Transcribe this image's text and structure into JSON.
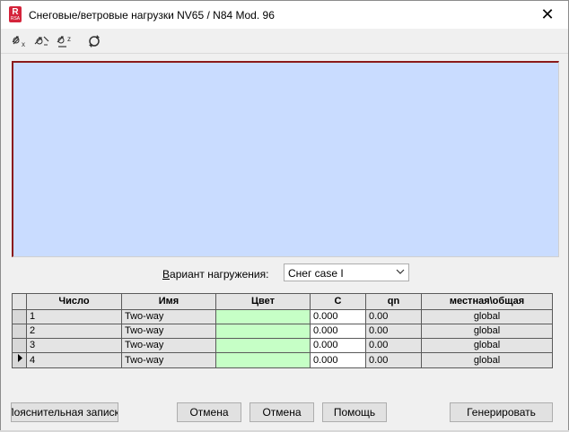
{
  "window": {
    "title": "Снеговые/ветровые нагрузки NV65 / N84 Mod. 96",
    "app_icon_letter": "R",
    "app_icon_sub": "RSA",
    "close_glyph": "✕"
  },
  "toolbar": {
    "icons": [
      "load-arrow-x-icon",
      "load-arrow-edit-icon",
      "load-arrow-z-icon",
      "refresh-icon"
    ]
  },
  "colors": {
    "canvas_bg": "#c9dcff",
    "canvas_border": "#8b1a1a",
    "color_cell": "#c6ffc6"
  },
  "variant": {
    "label_underlined": "В",
    "label_rest": "ариант нагружения:",
    "selected": "Снег case I"
  },
  "grid": {
    "headers": [
      "Число",
      "Имя",
      "Цвет",
      "C",
      "qn",
      "местная\\общая"
    ],
    "rows": [
      {
        "num": "1",
        "name": "Two-way",
        "c": "0.000",
        "qn": "0.00",
        "scope": "global",
        "current": false
      },
      {
        "num": "2",
        "name": "Two-way",
        "c": "0.000",
        "qn": "0.00",
        "scope": "global",
        "current": false
      },
      {
        "num": "3",
        "name": "Two-way",
        "c": "0.000",
        "qn": "0.00",
        "scope": "global",
        "current": false
      },
      {
        "num": "4",
        "name": "Two-way",
        "c": "0.000",
        "qn": "0.00",
        "scope": "global",
        "current": true
      }
    ]
  },
  "buttons": {
    "notes": "Пояснительная записка",
    "cancel1": "Отмена",
    "cancel2": "Отмена",
    "help": "Помощь",
    "generate": "Генерировать"
  }
}
